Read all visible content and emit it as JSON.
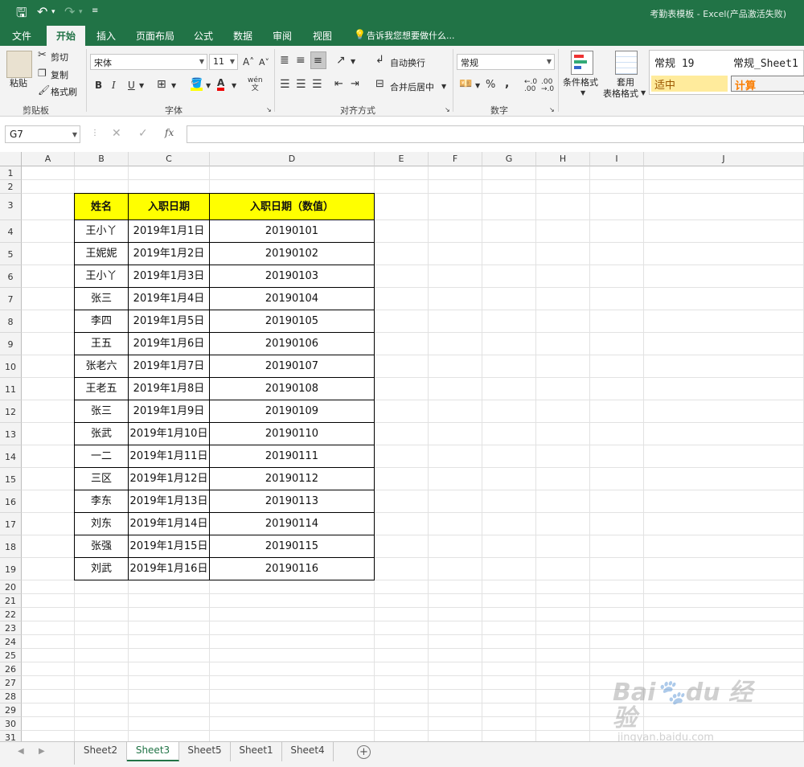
{
  "window": {
    "title": "考勤表模板 - Excel(产品激活失败)"
  },
  "quick_access": {
    "save_icon": "save-icon",
    "undo_icon": "undo-icon",
    "redo_icon": "redo-icon"
  },
  "ribbon_tabs": [
    "文件",
    "开始",
    "插入",
    "页面布局",
    "公式",
    "数据",
    "审阅",
    "视图"
  ],
  "active_tab": "开始",
  "tell_me": "告诉我您想要做什么...",
  "clipboard": {
    "paste": "粘贴",
    "cut": "剪切",
    "copy": "复制",
    "format_painter": "格式刷",
    "group": "剪贴板"
  },
  "font": {
    "name": "宋体",
    "size": "11",
    "bold": "B",
    "italic": "I",
    "underline": "U",
    "group": "字体",
    "phonetic": "wén"
  },
  "alignment": {
    "wrap": "自动换行",
    "merge": "合并后居中",
    "group": "对齐方式"
  },
  "number": {
    "format": "常规",
    "percent": "%",
    "comma": ",",
    "group": "数字"
  },
  "styles": {
    "conditional": "条件格式",
    "table_format_1": "套用",
    "table_format_2": "表格格式",
    "style1": "常规 19",
    "style2": "常规_Sheet1",
    "style3": "适中",
    "style4": "计算"
  },
  "formula_bar": {
    "name_box": "G7",
    "fx": "fx",
    "value": ""
  },
  "columns": [
    "A",
    "B",
    "C",
    "D",
    "E",
    "F",
    "G",
    "H",
    "I",
    "J"
  ],
  "rows": [
    "1",
    "2",
    "3",
    "4",
    "5",
    "6",
    "7",
    "8",
    "9",
    "10",
    "11",
    "12",
    "13",
    "14",
    "15",
    "16",
    "17",
    "18",
    "19",
    "20",
    "21",
    "22",
    "23",
    "24",
    "25",
    "26",
    "27",
    "28",
    "29",
    "30",
    "31"
  ],
  "table": {
    "headers": [
      "姓名",
      "入职日期",
      "入职日期（数值）"
    ],
    "rows": [
      [
        "王小丫",
        "2019年1月1日",
        "20190101"
      ],
      [
        "王妮妮",
        "2019年1月2日",
        "20190102"
      ],
      [
        "王小丫",
        "2019年1月3日",
        "20190103"
      ],
      [
        "张三",
        "2019年1月4日",
        "20190104"
      ],
      [
        "李四",
        "2019年1月5日",
        "20190105"
      ],
      [
        "王五",
        "2019年1月6日",
        "20190106"
      ],
      [
        "张老六",
        "2019年1月7日",
        "20190107"
      ],
      [
        "王老五",
        "2019年1月8日",
        "20190108"
      ],
      [
        "张三",
        "2019年1月9日",
        "20190109"
      ],
      [
        "张武",
        "2019年1月10日",
        "20190110"
      ],
      [
        "一二",
        "2019年1月11日",
        "20190111"
      ],
      [
        "三区",
        "2019年1月12日",
        "20190112"
      ],
      [
        "李东",
        "2019年1月13日",
        "20190113"
      ],
      [
        "刘东",
        "2019年1月14日",
        "20190114"
      ],
      [
        "张强",
        "2019年1月15日",
        "20190115"
      ],
      [
        "刘武",
        "2019年1月16日",
        "20190116"
      ]
    ]
  },
  "sheets": [
    "Sheet2",
    "Sheet3",
    "Sheet5",
    "Sheet1",
    "Sheet4"
  ],
  "active_sheet": "Sheet3",
  "watermark": "Baidu经验 jingyan.baidu.com",
  "colors": {
    "excel_green": "#217346",
    "header_fill": "#ffff00",
    "neutral_style": "#ffeb9c",
    "calc_style": "#f2f2f2",
    "calc_text": "#fa7d00"
  }
}
